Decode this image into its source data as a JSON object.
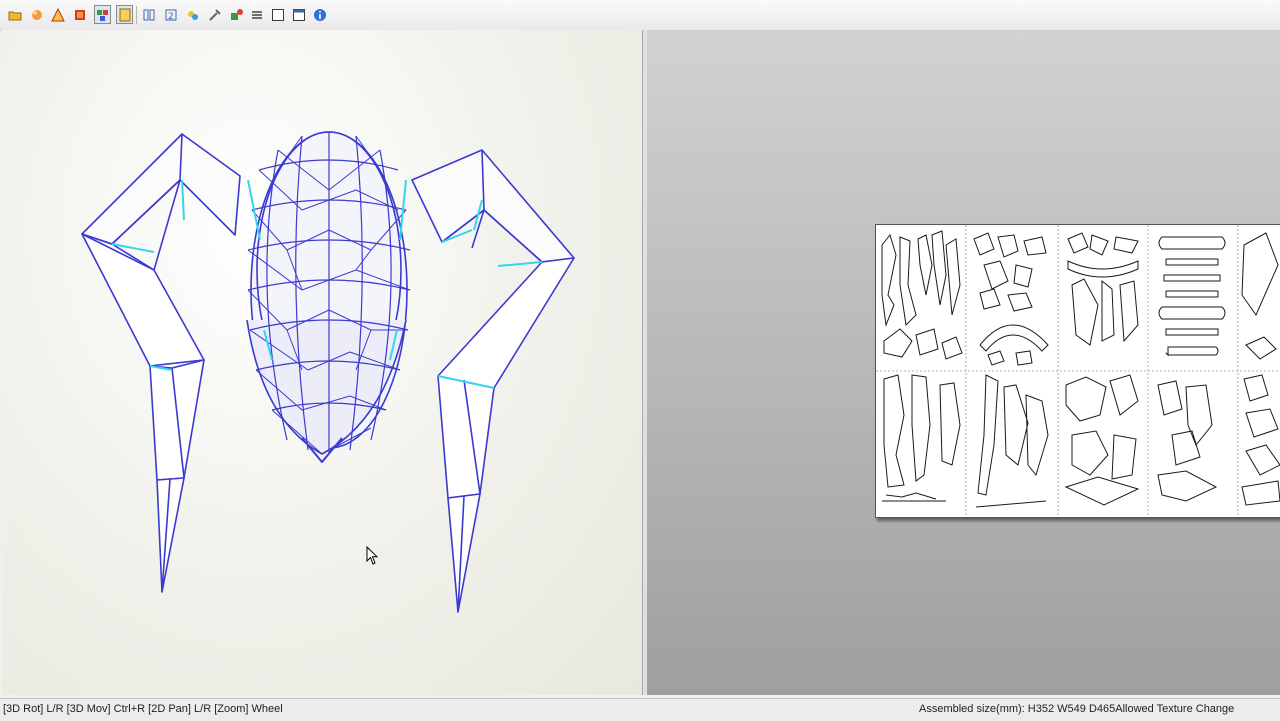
{
  "toolbar": {
    "buttons": [
      {
        "icon": "open-folder-icon"
      },
      {
        "icon": "import-model-icon"
      },
      {
        "icon": "warning-icon"
      },
      {
        "icon": "flag-icon"
      },
      {
        "icon": "unfold-icon",
        "active": true
      },
      {
        "icon": "texture-icon",
        "active": true
      },
      {
        "icon": "flip-icon"
      },
      {
        "icon": "number-icon"
      },
      {
        "icon": "join-icon"
      },
      {
        "icon": "tool-icon"
      },
      {
        "icon": "add-part-icon"
      },
      {
        "icon": "align-icon"
      },
      {
        "icon": "window-icon"
      },
      {
        "icon": "window-alt-icon"
      },
      {
        "icon": "info-icon"
      }
    ]
  },
  "status": {
    "left": "[3D Rot] L/R [3D Mov] Ctrl+R [2D Pan] L/R [Zoom] Wheel",
    "right": "Assembled size(mm): H352 W549 D465Allowed Texture Change"
  },
  "colors": {
    "wire": "#3a3ad0",
    "accent_edge": "#33d6f0",
    "sheet_line": "#1a1a1a"
  }
}
